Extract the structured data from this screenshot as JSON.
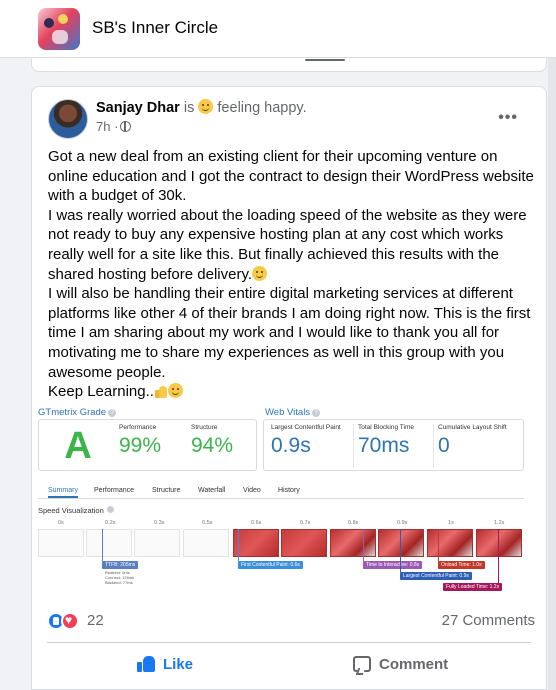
{
  "group": {
    "name": "SB's Inner Circle"
  },
  "post": {
    "author": "Sanjay Dhar",
    "feeling_prefix": "is",
    "feeling": "feeling happy.",
    "time": "7h ·",
    "paragraphs": [
      "Got a new deal from an existing client for their upcoming venture on online education and I got the contract to design their WordPress website with a budget of 30k.",
      "I was really worried about the loading speed of the website as they were not ready to buy any expensive hosting plan at any cost which works really well for a site like this. But finally achieved this results with the shared hosting before delivery.",
      "I will also be handling their entire digital marketing services at different platforms like other 4 of their brands I am doing right now. This is the first time I am sharing about my work and I would like to thank you all for motivating me to share my experiences as well in this group with you awesome people.",
      "Keep Learning.."
    ]
  },
  "report": {
    "grade_title": "GTmetrix Grade",
    "vitals_title": "Web Vitals",
    "grade": "A",
    "performance_label": "Performance",
    "performance": "99%",
    "structure_label": "Structure",
    "structure": "94%",
    "lcp_label": "Largest Contentful Paint",
    "lcp": "0.9s",
    "tbt_label": "Total Blocking Time",
    "tbt": "70ms",
    "cls_label": "Cumulative Layout Shift",
    "cls": "0",
    "tabs": [
      "Summary",
      "Performance",
      "Structure",
      "Waterfall",
      "Video",
      "History"
    ],
    "speed_title": "Speed Visualization",
    "ticks": [
      "0s",
      "0.2s",
      "0.3s",
      "0.5s",
      "0.6s",
      "0.7s",
      "0.8s",
      "0.9s",
      "1s",
      "1.2s"
    ],
    "markers": {
      "ttfb": "TTFB: 205ms",
      "ttfb_sub1": "Redirect: 0ms",
      "ttfb_sub2": "Connect: 129ms",
      "ttfb_sub3": "Backend: 77ms",
      "fcp": "First Contentful Paint: 0.6s",
      "tti": "Time to Interactive: 0.8s",
      "onload": "Onload Time: 1.0s",
      "lcp": "Largest Contentful Paint: 0.9s",
      "fully": "Fully Loaded Time: 1.2s"
    }
  },
  "reactions": {
    "count": "22",
    "comments": "27 Comments"
  },
  "actions": {
    "like": "Like",
    "comment": "Comment"
  },
  "colors": {
    "brand": "#1877f2",
    "grade_green": "#3ab54a",
    "gt_blue": "#2d74b5"
  }
}
